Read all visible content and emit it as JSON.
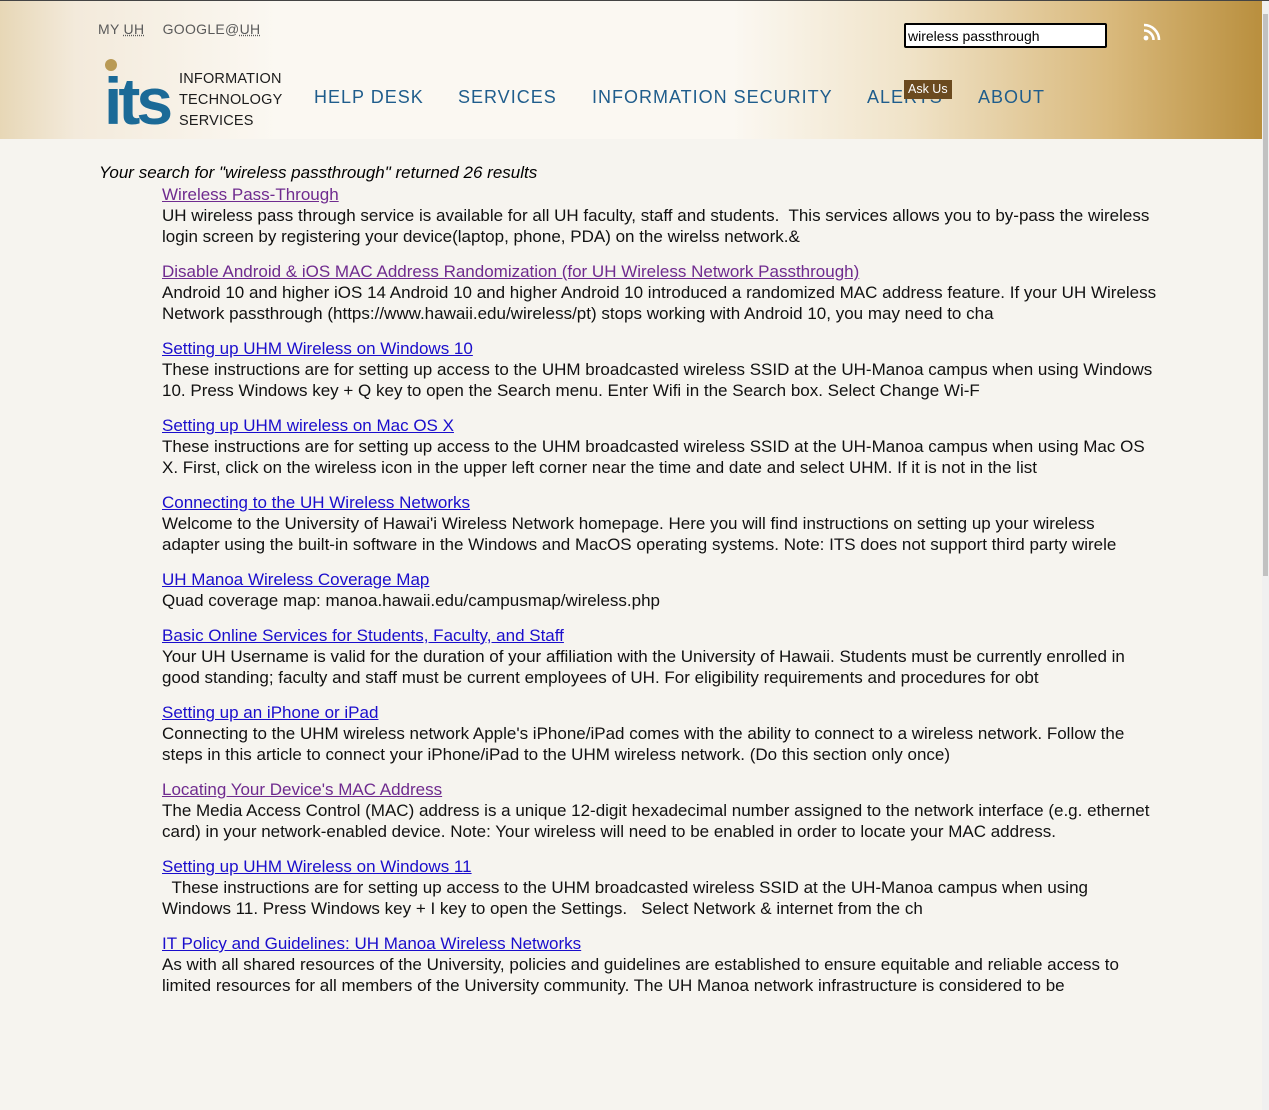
{
  "header": {
    "top_links": {
      "my_prefix": "MY ",
      "my_abbr": "UH",
      "google_prefix": "GOOGLE@",
      "google_abbr": "UH"
    },
    "logo": {
      "mark": "its",
      "line1": "INFORMATION",
      "line2": "TECHNOLOGY",
      "line3": "SERVICES"
    },
    "nav": [
      "HELP DESK",
      "SERVICES",
      "INFORMATION SECURITY",
      "ALERTS",
      "ABOUT"
    ],
    "ask_us": "Ask Us",
    "search_value": "wireless passthrough",
    "rss_icon": "rss-icon"
  },
  "colors": {
    "nav_text": "#1f5d8c",
    "logo_blue": "#1b6a97",
    "logo_gold": "#b99a55",
    "visited_link": "#6f2b8f",
    "unvisited_link": "#1a0dcc",
    "ask_us_bg": "#6b4a1f"
  },
  "search": {
    "summary": "Your search for \"wireless passthrough\" returned 26 results",
    "results": [
      {
        "title": "Wireless Pass-Through",
        "visited": true,
        "snippet": "UH wireless pass through service is available for all UH faculty, staff and students.  This services allows you to by-pass the wireless login screen by registering your device(laptop, phone, PDA) on the wirelss network.&"
      },
      {
        "title": "Disable Android & iOS MAC Address Randomization (for UH Wireless Network Passthrough)",
        "visited": true,
        "snippet": "Android 10 and higher iOS 14 Android 10 and higher Android 10 introduced a randomized MAC address feature. If your UH Wireless Network passthrough (https://www.hawaii.edu/wireless/pt) stops working with Android 10, you may need to cha"
      },
      {
        "title": "Setting up UHM Wireless on Windows 10",
        "visited": false,
        "snippet": "These instructions are for setting up access to the UHM broadcasted wireless SSID at the UH-Manoa campus when using Windows 10. Press Windows key + Q key to open the Search menu. Enter Wifi in the Search box. Select Change Wi-F"
      },
      {
        "title": "Setting up UHM wireless on Mac OS X",
        "visited": false,
        "snippet": "These instructions are for setting up access to the UHM broadcasted wireless SSID at the UH-Manoa campus when using Mac OS X. First, click on the wireless icon in the upper left corner near the time and date and select UHM. If it is not in the list"
      },
      {
        "title": "Connecting to the UH Wireless Networks",
        "visited": false,
        "snippet": "Welcome to the University of Hawai'i Wireless Network homepage. Here you will find instructions on setting up your wireless adapter using the built-in software in the Windows and MacOS operating systems. Note: ITS does not support third party wirele"
      },
      {
        "title": "UH Manoa Wireless Coverage Map",
        "visited": false,
        "snippet": "Quad coverage map: manoa.hawaii.edu/campusmap/wireless.php"
      },
      {
        "title": "Basic Online Services for Students, Faculty, and Staff",
        "visited": false,
        "snippet": "Your UH Username is valid for the duration of your affiliation with the University of Hawaii. Students must be currently enrolled in good standing; faculty and staff must be current employees of UH. For eligibility requirements and procedures for obt"
      },
      {
        "title": "Setting up an iPhone or iPad",
        "visited": false,
        "snippet": "Connecting to the UHM wireless network Apple's iPhone/iPad comes with the ability to connect to a wireless network. Follow the steps in this article to connect your iPhone/iPad to the UHM wireless network. (Do this section only once)"
      },
      {
        "title": "Locating Your Device's MAC Address",
        "visited": true,
        "snippet": "The Media Access Control (MAC) address is a unique 12-digit hexadecimal number assigned to the network interface (e.g. ethernet card) in your network-enabled device. Note: Your wireless will need to be enabled in order to locate your MAC address."
      },
      {
        "title": "Setting up UHM Wireless on Windows 11",
        "visited": false,
        "snippet": "  These instructions are for setting up access to the UHM broadcasted wireless SSID at the UH-Manoa campus when using Windows 11. Press Windows key + I key to open the Settings.   Select Network & internet from the ch"
      },
      {
        "title": "IT Policy and Guidelines: UH Manoa Wireless Networks",
        "visited": false,
        "snippet": "As with all shared resources of the University, policies and guidelines are established to ensure equitable and reliable access to limited resources for all members of the University community. The UH Manoa network infrastructure is considered to be"
      }
    ]
  }
}
